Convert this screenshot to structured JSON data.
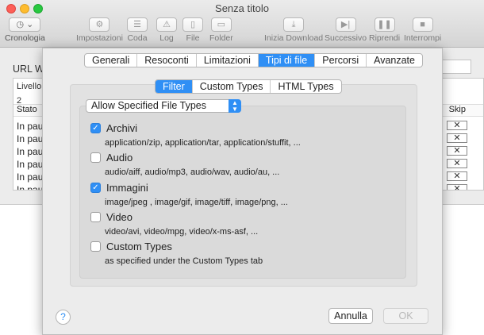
{
  "window": {
    "title": "Senza titolo"
  },
  "toolbar": {
    "cronologia": "Cronologia",
    "impostazioni": "Impostazioni",
    "coda": "Coda",
    "log": "Log",
    "file": "File",
    "folder": "Folder",
    "inizia_download": "Inizia Download",
    "successivo": "Successivo",
    "riprendi": "Riprendi",
    "interrompi": "Interrompi"
  },
  "main": {
    "url_label": "URL We",
    "list": {
      "header_livello": "Livello",
      "header_level_value": "2",
      "col_stato": "Stato",
      "col_skip": "Skip",
      "rows": [
        "In paus",
        "In paus",
        "In paus",
        "In paus",
        "In paus",
        "In paus"
      ]
    }
  },
  "sheet": {
    "tabs": [
      "Generali",
      "Resoconti",
      "Limitazioni",
      "Tipi di file",
      "Percorsi",
      "Avanzate"
    ],
    "active_tab": "Tipi di file",
    "subtabs": [
      "Filter",
      "Custom Types",
      "HTML Types"
    ],
    "active_subtab": "Filter",
    "filter_mode": "Allow Specified File Types",
    "types": [
      {
        "label": "Archivi",
        "checked": true,
        "desc": "application/zip, application/tar, application/stuffit, ..."
      },
      {
        "label": "Audio",
        "checked": false,
        "desc": "audio/aiff, audio/mp3, audio/wav, audio/au, ..."
      },
      {
        "label": "Immagini",
        "checked": true,
        "desc": "image/jpeg , image/gif, image/tiff, image/png, ..."
      },
      {
        "label": "Video",
        "checked": false,
        "desc": "video/avi, video/mpg, video/x-ms-asf, ..."
      },
      {
        "label": "Custom Types",
        "checked": false,
        "desc": "as specified under the Custom Types tab"
      }
    ],
    "help": "?",
    "cancel": "Annulla",
    "ok": "OK"
  },
  "colors": {
    "accent": "#2f8ff5"
  }
}
